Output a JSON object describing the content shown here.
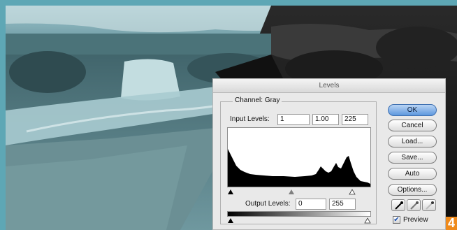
{
  "dialog": {
    "title": "Levels",
    "channel_label": "Channel:",
    "channel_value": "Gray",
    "input_levels_label": "Input Levels:",
    "input_black": "1",
    "input_gamma": "1.00",
    "input_white": "225",
    "output_levels_label": "Output Levels:",
    "output_black": "0",
    "output_white": "255",
    "buttons": {
      "ok": "OK",
      "cancel": "Cancel",
      "load": "Load...",
      "save": "Save...",
      "auto": "Auto",
      "options": "Options..."
    },
    "preview_label": "Preview",
    "preview_checked": true,
    "eyedroppers": [
      "black-eyedropper-icon",
      "gray-eyedropper-icon",
      "white-eyedropper-icon"
    ]
  },
  "step_badge": "4",
  "colors": {
    "background": "#5ea7b5",
    "accent_badge": "#ef8a1b",
    "ok_button": "#5e98de"
  }
}
